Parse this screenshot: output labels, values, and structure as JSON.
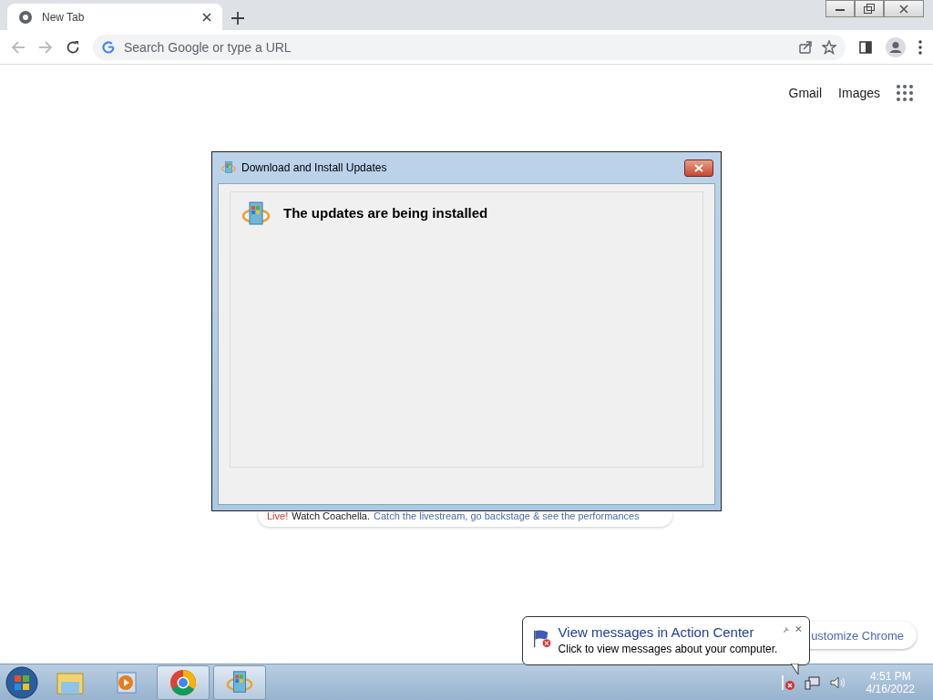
{
  "browser": {
    "tab": {
      "title": "New Tab"
    },
    "omnibox": {
      "placeholder": "Search Google or type a URL"
    },
    "header_links": [
      "Gmail",
      "Images"
    ],
    "promo": {
      "live": "Live!",
      "lead": "Watch Coachella.",
      "link": "Catch the livestream, go backstage & see the performances"
    },
    "customize": "ustomize Chrome"
  },
  "dialog": {
    "title": "Download and Install Updates",
    "heading": "The updates are being installed"
  },
  "balloon": {
    "title": "View messages in Action Center",
    "text": "Click to view messages about your computer."
  },
  "taskbar": {
    "items": [
      {
        "kind": "explorer",
        "running": false
      },
      {
        "kind": "media",
        "running": false
      },
      {
        "kind": "chrome",
        "running": true
      },
      {
        "kind": "update",
        "running": true
      }
    ],
    "time": "4:51 PM",
    "date": "4/16/2022"
  }
}
